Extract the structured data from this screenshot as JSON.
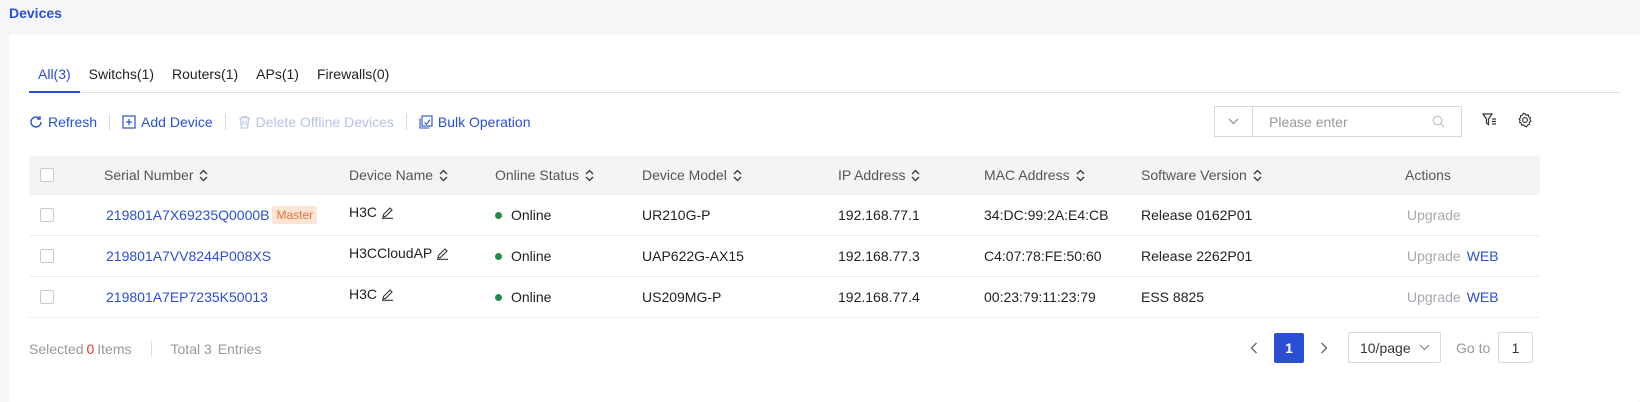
{
  "page_title": "Devices",
  "tabs": [
    {
      "label": "All(3)",
      "active": true
    },
    {
      "label": "Switchs(1)",
      "active": false
    },
    {
      "label": "Routers(1)",
      "active": false
    },
    {
      "label": "APs(1)",
      "active": false
    },
    {
      "label": "Firewalls(0)",
      "active": false
    }
  ],
  "toolbar": {
    "refresh": "Refresh",
    "add_device": "Add Device",
    "delete_offline": "Delete Offline Devices",
    "bulk_operation": "Bulk Operation"
  },
  "search": {
    "placeholder": "Please enter",
    "value": ""
  },
  "table": {
    "columns": {
      "serial": "Serial Number",
      "name": "Device Name",
      "status": "Online Status",
      "model": "Device Model",
      "ip": "IP Address",
      "mac": "MAC Address",
      "version": "Software Version",
      "actions": "Actions"
    },
    "rows": [
      {
        "serial": "219801A7X69235Q0000B",
        "badge": "Master",
        "name": "H3C",
        "status": "Online",
        "model": "UR210G-P",
        "ip": "192.168.77.1",
        "mac": "34:DC:99:2A:E4:CB",
        "version": "Release 0162P01",
        "upgrade": "Upgrade",
        "web": ""
      },
      {
        "serial": "219801A7VV8244P008XS",
        "badge": "",
        "name": "H3CCloudAP",
        "status": "Online",
        "model": "UAP622G-AX15",
        "ip": "192.168.77.3",
        "mac": "C4:07:78:FE:50:60",
        "version": "Release 2262P01",
        "upgrade": "Upgrade",
        "web": "WEB"
      },
      {
        "serial": "219801A7EP7235K50013",
        "badge": "",
        "name": "H3C",
        "status": "Online",
        "model": "US209MG-P",
        "ip": "192.168.77.4",
        "mac": "00:23:79:11:23:79",
        "version": "ESS 8825",
        "upgrade": "Upgrade",
        "web": "WEB"
      }
    ]
  },
  "footer": {
    "selected_prefix": "Selected",
    "selected_count": "0",
    "selected_suffix": "Items",
    "total": "Total 3",
    "entries": "Entries",
    "current_page": "1",
    "page_size": "10/page",
    "goto_label": "Go to",
    "goto_value": "1"
  },
  "colors": {
    "accent": "#2a4fd4",
    "online": "#1e8f4e",
    "master_badge_bg": "#fde4d5",
    "master_badge_text": "#e0743a",
    "selected_count": "#e9352c"
  }
}
